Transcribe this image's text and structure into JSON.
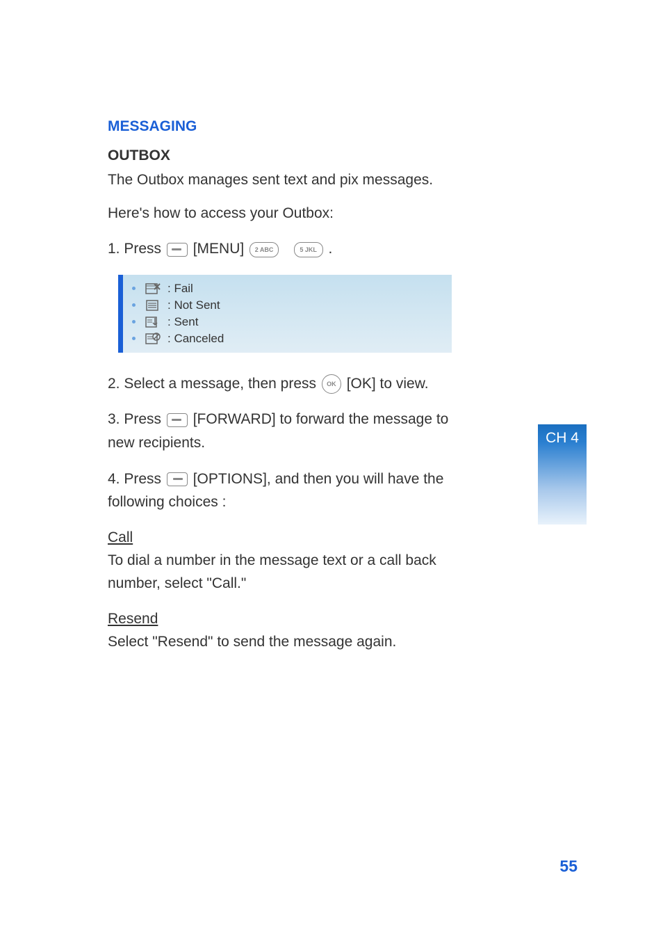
{
  "section_title": "MESSAGING",
  "subheading": "OUTBOX",
  "intro_line1": "The Outbox manages sent text and pix messages.",
  "intro_line2": "Here's how to access your Outbox:",
  "step1_pre": "1. Press ",
  "step1_menu": " [MENU] ",
  "step1_end": " .",
  "key2": "2 ABC",
  "key5": "5 JKL",
  "status": {
    "fail": " : Fail",
    "notsent": " : Not Sent",
    "sent": " : Sent",
    "canceled": " : Canceled"
  },
  "step2_pre": "2. Select a message, then press ",
  "ok_label": "OK",
  "step2_post": " [OK] to view.",
  "step3_pre": "3. Press ",
  "step3_post": " [FORWARD] to forward the message to new recipients.",
  "step4_pre": "4. Press ",
  "step4_post": " [OPTIONS], and then you will have the following choices :",
  "call_head": "Call",
  "call_body": "To dial a number in the message text or a call back number, select \"Call.\"",
  "resend_head": "Resend",
  "resend_body": "Select \"Resend\" to send the message again.",
  "sidebar": "CH 4",
  "page_number": "55"
}
